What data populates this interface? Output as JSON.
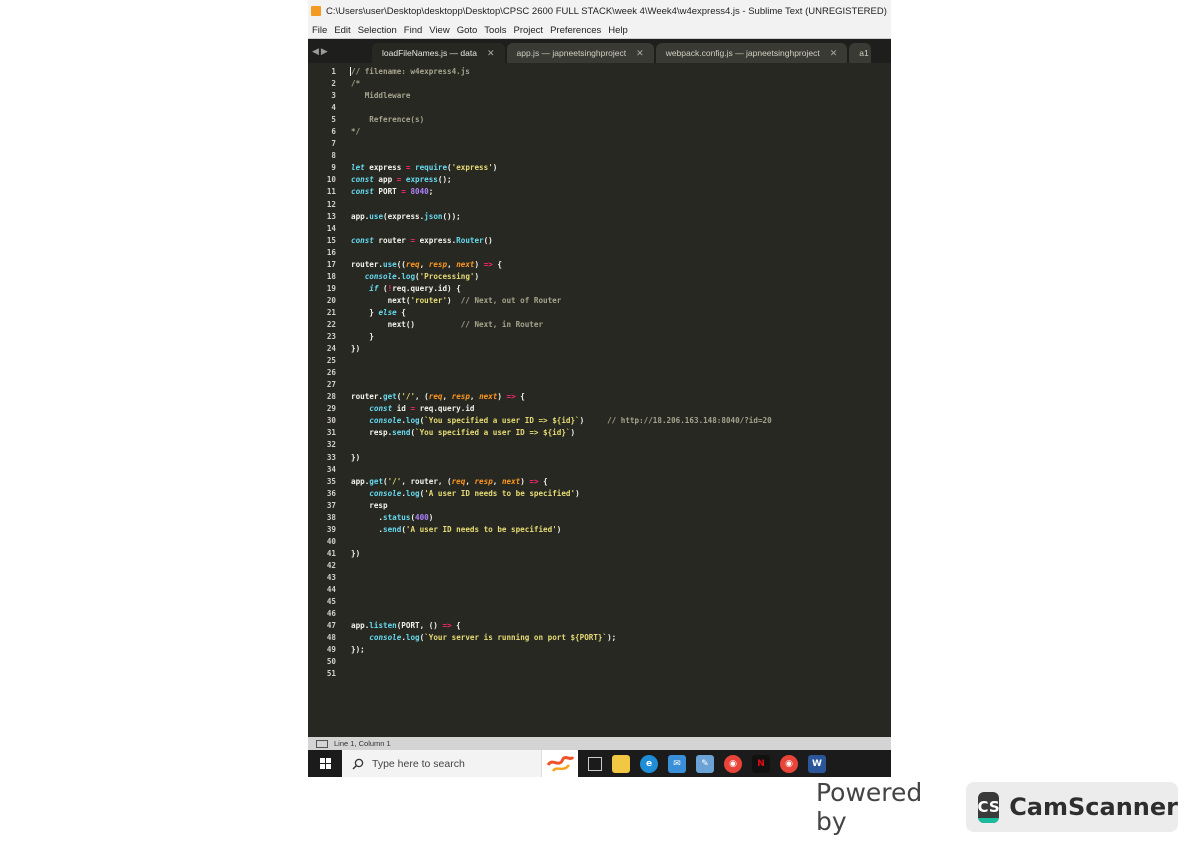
{
  "window": {
    "title": "C:\\Users\\user\\Desktop\\desktopp\\Desktop\\CPSC 2600 FULL STACK\\week 4\\Week4\\w4express4.js - Sublime Text (UNREGISTERED)"
  },
  "menu": [
    "File",
    "Edit",
    "Selection",
    "Find",
    "View",
    "Goto",
    "Tools",
    "Project",
    "Preferences",
    "Help"
  ],
  "tabs": [
    {
      "label": "loadFileNames.js — data",
      "active": true
    },
    {
      "label": "app.js — japneetsinghproject",
      "active": false
    },
    {
      "label": "webpack.config.js — japneetsinghproject",
      "active": false
    },
    {
      "label": "a1",
      "active": false
    }
  ],
  "code_lines": [
    "// filename: w4express4.js",
    "/*",
    "   Middleware",
    "",
    "    Reference(s)",
    "*/",
    "",
    "",
    "let express = require('express')",
    "const app = express();",
    "const PORT = 8040;",
    "",
    "app.use(express.json());",
    "",
    "const router = express.Router()",
    "",
    "router.use((req, resp, next) => {",
    "   console.log('Processing')",
    "    if (!req.query.id) {",
    "        next('router')  // Next, out of Router",
    "    } else {",
    "        next()          // Next, in Router",
    "    }",
    "})",
    "",
    "",
    "",
    "router.get('/', (req, resp, next) => {",
    "    const id = req.query.id",
    "    console.log(`You specified a user ID => ${id}`)     // http://18.206.163.148:8040/?id=20",
    "    resp.send(`You specified a user ID => ${id}`)",
    "",
    "})",
    "",
    "app.get('/', router, (req, resp, next) => {",
    "    console.log('A user ID needs to be specified')",
    "    resp",
    "      .status(400)",
    "      .send('A user ID needs to be specified')",
    "",
    "})",
    "",
    "",
    "",
    "",
    "",
    "app.listen(PORT, () => {",
    "    console.log(`Your server is running on port ${PORT}`);",
    "});",
    "",
    ""
  ],
  "status": {
    "position": "Line 1, Column 1"
  },
  "taskbar": {
    "search_placeholder": "Type here to search",
    "icons": [
      "task-view",
      "file-explorer",
      "edge",
      "mail",
      "notepad",
      "chrome",
      "netflix",
      "chrome-alt",
      "word"
    ]
  },
  "footer": {
    "powered_by": "Powered by",
    "brand_badge": "CS",
    "brand_name": "CamScanner"
  },
  "colors": {
    "editor_bg": "#272822",
    "keyword": "#66d9ef",
    "string": "#e6db74",
    "number": "#ae81ff",
    "operator": "#f92672",
    "comment": "#a6a48e",
    "param": "#fd971f"
  }
}
